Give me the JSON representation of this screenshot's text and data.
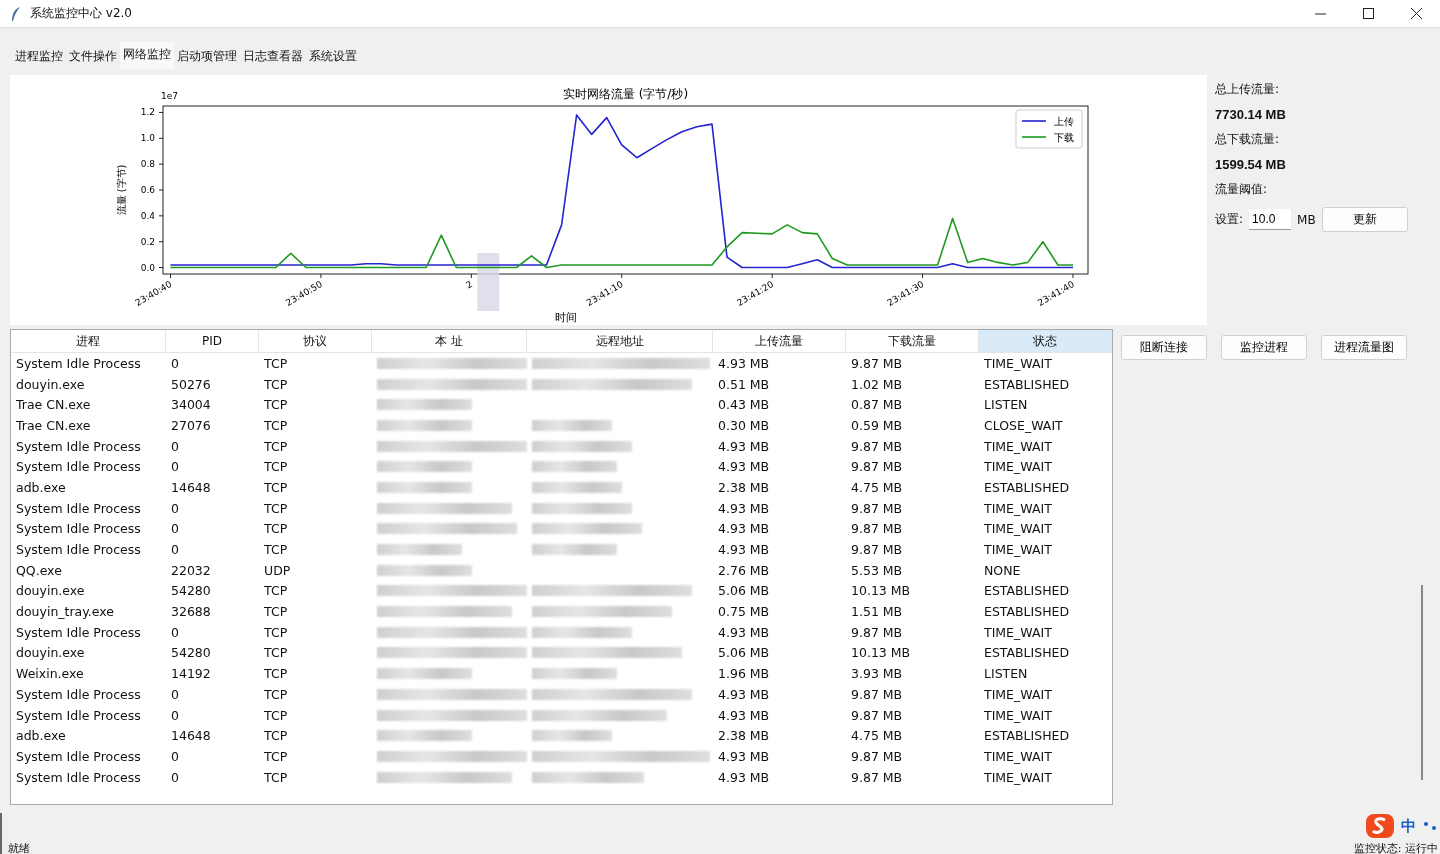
{
  "window": {
    "title": "系统监控中心 v2.0"
  },
  "tabs": [
    {
      "label": "进程监控",
      "selected": false
    },
    {
      "label": "文件操作",
      "selected": false
    },
    {
      "label": "网络监控",
      "selected": true
    },
    {
      "label": "启动项管理",
      "selected": false
    },
    {
      "label": "日志查看器",
      "selected": false
    },
    {
      "label": "系统设置",
      "selected": false
    }
  ],
  "chart": {
    "chart_data": {
      "type": "line",
      "title": "实时网络流量 (字节/秒)",
      "xlabel": "时间",
      "ylabel": "流量 (字节)",
      "categories": [
        "23:40:40",
        null,
        null,
        null,
        null,
        null,
        null,
        null,
        null,
        null,
        "23:40:50",
        null,
        null,
        null,
        null,
        null,
        null,
        null,
        null,
        null,
        "2",
        null,
        null,
        null,
        null,
        null,
        null,
        null,
        null,
        null,
        "23:41:10",
        null,
        null,
        null,
        null,
        null,
        null,
        null,
        null,
        null,
        "23:41:20",
        null,
        null,
        null,
        null,
        null,
        null,
        null,
        null,
        null,
        "23:41:30",
        null,
        null,
        null,
        null,
        null,
        null,
        null,
        null,
        null,
        "23:41:40"
      ],
      "series": [
        {
          "name": "上传",
          "color": "#2424d0",
          "values": [
            0.02,
            0.02,
            0.02,
            0.02,
            0.02,
            0.02,
            0.02,
            0.02,
            0.02,
            0.02,
            0.02,
            0.02,
            0.02,
            0.03,
            0.03,
            0.02,
            0.02,
            0.02,
            0.02,
            0.02,
            0.02,
            0.02,
            0.02,
            0.02,
            0.02,
            0.02,
            0.33,
            1.18,
            1.03,
            1.16,
            0.95,
            0.85,
            0.92,
            0.99,
            1.05,
            1.09,
            1.11,
            0.08,
            0.0,
            0.0,
            0.0,
            0.0,
            0.03,
            0.06,
            0.0,
            0.0,
            0.0,
            0.0,
            0.0,
            0.0,
            0.0,
            0.0,
            0.03,
            0.0,
            0.0,
            0.0,
            0.0,
            0.0,
            0.0,
            0.0,
            0.0
          ]
        },
        {
          "name": "下载",
          "color": "#1f9a1f",
          "values": [
            0.0,
            0.0,
            0.0,
            0.0,
            0.0,
            0.0,
            0.0,
            0.0,
            0.11,
            0.0,
            0.0,
            0.0,
            0.0,
            0.0,
            0.0,
            0.0,
            0.0,
            0.0,
            0.25,
            0.0,
            0.0,
            0.0,
            0.0,
            0.0,
            0.09,
            0.0,
            0.02,
            0.02,
            0.02,
            0.02,
            0.02,
            0.02,
            0.02,
            0.02,
            0.02,
            0.02,
            0.02,
            0.16,
            0.27,
            0.265,
            0.26,
            0.33,
            0.27,
            0.26,
            0.07,
            0.02,
            0.02,
            0.02,
            0.02,
            0.02,
            0.02,
            0.02,
            0.38,
            0.04,
            0.07,
            0.04,
            0.02,
            0.04,
            0.2,
            0.02,
            0.02
          ]
        }
      ],
      "legend": true,
      "ylim": [
        -0.05,
        1.25
      ],
      "yticks": [
        {
          "value": 0,
          "label": "0.0"
        },
        {
          "value": 0.2,
          "label": "0.2"
        },
        {
          "value": 0.4,
          "label": "0.4"
        },
        {
          "value": 0.6,
          "label": "0.6"
        },
        {
          "value": 0.8,
          "label": "0.8"
        },
        {
          "value": 1.0,
          "label": "1.0"
        },
        {
          "value": 1.2,
          "label": "1.2"
        }
      ],
      "annotations": [
        "1e7"
      ]
    }
  },
  "stats": [
    {
      "label": "总上传流量:",
      "value": "7730.14 MB"
    },
    {
      "label": "总下载流量:",
      "value": "1599.54 MB"
    }
  ],
  "threshold": {
    "label": "流量阈值:",
    "field_label": "设置:",
    "value": "10.0",
    "unit": "MB",
    "button": "更新"
  },
  "table": {
    "columns": [
      {
        "label": "进程",
        "selected": false
      },
      {
        "label": "PID",
        "selected": false
      },
      {
        "label": "协议",
        "selected": false
      },
      {
        "label": "本  址",
        "selected": false
      },
      {
        "label": "远程地址",
        "selected": false
      },
      {
        "label": "上传流量",
        "selected": false
      },
      {
        "label": "下载流量",
        "selected": false
      },
      {
        "label": "状态",
        "selected": true
      }
    ],
    "rows": [
      [
        "System Idle Process",
        "0",
        "TCP",
        "4.93 MB",
        "9.87 MB",
        "TIME_WAIT"
      ],
      [
        "douyin.exe",
        "50276",
        "TCP",
        "0.51 MB",
        "1.02 MB",
        "ESTABLISHED"
      ],
      [
        "Trae CN.exe",
        "34004",
        "TCP",
        "0.43 MB",
        "0.87 MB",
        "LISTEN"
      ],
      [
        "Trae CN.exe",
        "27076",
        "TCP",
        "0.30 MB",
        "0.59 MB",
        "CLOSE_WAIT"
      ],
      [
        "System Idle Process",
        "0",
        "TCP",
        "4.93 MB",
        "9.87 MB",
        "TIME_WAIT"
      ],
      [
        "System Idle Process",
        "0",
        "TCP",
        "4.93 MB",
        "9.87 MB",
        "TIME_WAIT"
      ],
      [
        "adb.exe",
        "14648",
        "TCP",
        "2.38 MB",
        "4.75 MB",
        "ESTABLISHED"
      ],
      [
        "System Idle Process",
        "0",
        "TCP",
        "4.93 MB",
        "9.87 MB",
        "TIME_WAIT"
      ],
      [
        "System Idle Process",
        "0",
        "TCP",
        "4.93 MB",
        "9.87 MB",
        "TIME_WAIT"
      ],
      [
        "System Idle Process",
        "0",
        "TCP",
        "4.93 MB",
        "9.87 MB",
        "TIME_WAIT"
      ],
      [
        "QQ.exe",
        "22032",
        "UDP",
        "2.76 MB",
        "5.53 MB",
        "NONE"
      ],
      [
        "douyin.exe",
        "54280",
        "TCP",
        "5.06 MB",
        "10.13 MB",
        "ESTABLISHED"
      ],
      [
        "douyin_tray.exe",
        "32688",
        "TCP",
        "0.75 MB",
        "1.51 MB",
        "ESTABLISHED"
      ],
      [
        "System Idle Process",
        "0",
        "TCP",
        "4.93 MB",
        "9.87 MB",
        "TIME_WAIT"
      ],
      [
        "douyin.exe",
        "54280",
        "TCP",
        "5.06 MB",
        "10.13 MB",
        "ESTABLISHED"
      ],
      [
        "Weixin.exe",
        "14192",
        "TCP",
        "1.96 MB",
        "3.93 MB",
        "LISTEN"
      ],
      [
        "System Idle Process",
        "0",
        "TCP",
        "4.93 MB",
        "9.87 MB",
        "TIME_WAIT"
      ],
      [
        "System Idle Process",
        "0",
        "TCP",
        "4.93 MB",
        "9.87 MB",
        "TIME_WAIT"
      ],
      [
        "adb.exe",
        "14648",
        "TCP",
        "2.38 MB",
        "4.75 MB",
        "ESTABLISHED"
      ],
      [
        "System Idle Process",
        "0",
        "TCP",
        "4.93 MB",
        "9.87 MB",
        "TIME_WAIT"
      ],
      [
        "System Idle Process",
        "0",
        "TCP",
        "4.93 MB",
        "9.87 MB",
        "TIME_WAIT"
      ]
    ]
  },
  "actions": [
    "阻断连接",
    "监控进程",
    "进程流量图"
  ],
  "status_bar": {
    "left": "就绪",
    "ime": "中",
    "right": "监控状态: 运行中"
  }
}
